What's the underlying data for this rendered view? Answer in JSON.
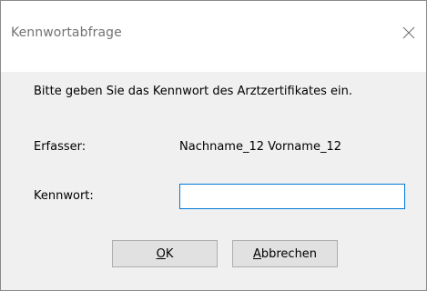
{
  "window": {
    "title": "Kennwortabfrage",
    "close_icon": "close-icon"
  },
  "dialog": {
    "message": "Bitte geben Sie das Kennwort des Arztzertifikates ein.",
    "erfasser_label": "Erfasser:",
    "erfasser_value": "Nachname_12 Vorname_12",
    "kennwort_label": "Kennwort:",
    "kennwort_value": ""
  },
  "buttons": {
    "ok_mnemonic": "O",
    "ok_rest": "K",
    "cancel_mnemonic": "A",
    "cancel_rest": "bbrechen"
  },
  "colors": {
    "focus_border": "#0078d7",
    "dialog_background": "#f0f0f0",
    "titlebar_background": "#ffffff"
  }
}
